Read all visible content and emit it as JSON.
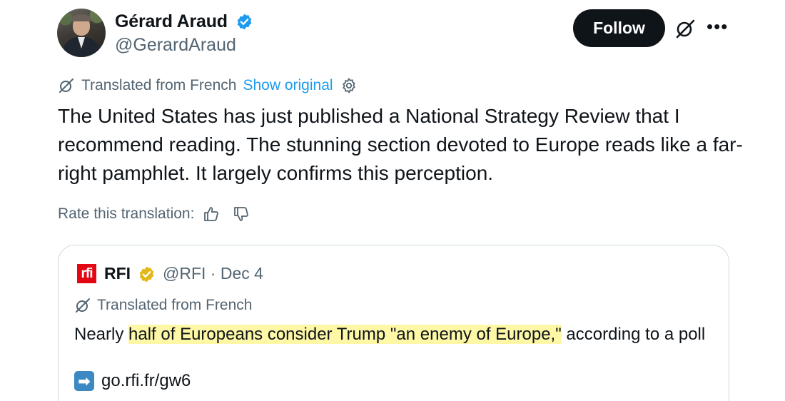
{
  "author": {
    "display_name": "Gérard Araud",
    "handle": "@GerardAraud",
    "verified": true,
    "verified_color": "#1d9bf0"
  },
  "actions": {
    "follow_label": "Follow",
    "grok_icon": "grok-icon",
    "more_icon": "more-icon"
  },
  "translation": {
    "label": "Translated from French",
    "show_original": "Show original"
  },
  "tweet": {
    "text": "The United States has just published a National Strategy Review that I recommend reading. The stunning section devoted to Europe reads like a far-right pamphlet. It largely confirms this perception."
  },
  "rate": {
    "label": "Rate this translation:"
  },
  "quote": {
    "logo_text": "rfi",
    "name": "RFI",
    "badge_color": "#e2b719",
    "meta": "@RFI · Dec 4",
    "translated_label": "Translated from French",
    "text_before": "Nearly ",
    "text_highlight": "half of Europeans consider Trump \"an enemy of Europe,\"",
    "text_after": " according to a poll",
    "highlight_color": "#fdf7a6",
    "link_arrow": "➡",
    "link": "go.rfi.fr/gw6"
  }
}
